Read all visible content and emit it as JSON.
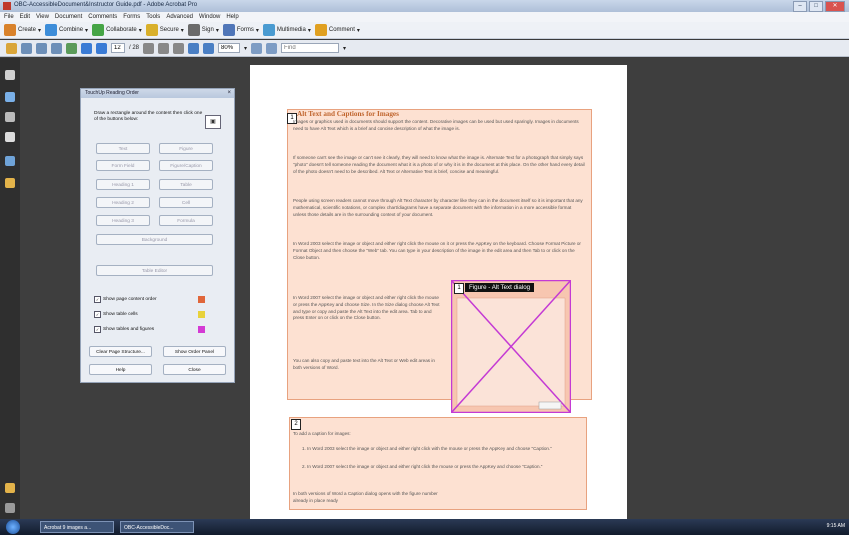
{
  "window": {
    "title": "OBC-AccessibleDocument&Instructor Guide.pdf - Adobe Acrobat Pro",
    "minimize": "–",
    "maximize": "□",
    "close": "✕"
  },
  "menu": [
    "File",
    "Edit",
    "View",
    "Document",
    "Comments",
    "Forms",
    "Tools",
    "Advanced",
    "Window",
    "Help"
  ],
  "toolbar1": [
    {
      "label": "Create",
      "color": "#d9822b"
    },
    {
      "label": "Combine",
      "color": "#3d8dd9"
    },
    {
      "label": "Collaborate",
      "color": "#46a546"
    },
    {
      "label": "Secure",
      "color": "#d9b02b"
    },
    {
      "label": "Sign",
      "color": "#6b6b6b"
    },
    {
      "label": "Forms",
      "color": "#5076b8"
    },
    {
      "label": "Multimedia",
      "color": "#4a9bd1"
    },
    {
      "label": "Comment",
      "color": "#e0a020"
    }
  ],
  "toolbar2": {
    "page_current": "12",
    "page_total": "/ 28",
    "zoom": "80%",
    "find_placeholder": "Find"
  },
  "dialog": {
    "title": "TouchUp Reading Order",
    "close": "×",
    "instruction": "Draw a rectangle around the content then click one of the buttons below:",
    "buttons": {
      "text": "Text",
      "figure": "Figure",
      "form_field": "Form Field",
      "figure_caption": "Figure/Caption",
      "heading1": "Heading 1",
      "table": "Table",
      "heading2": "Heading 2",
      "cell": "Cell",
      "heading3": "Heading 3",
      "formula": "Formula",
      "background": "Background",
      "table_editor": "Table Editor",
      "clear_page": "Clear Page Structure...",
      "show_order": "Show Order Panel",
      "help": "Help",
      "close": "Close"
    },
    "checkboxes": [
      {
        "label": "Show page content order",
        "checked": "✓",
        "color": "#e0663a"
      },
      {
        "label": "Show table cells",
        "checked": "✓",
        "color": "#e8d23a"
      },
      {
        "label": "Show tables and figures",
        "checked": "✓",
        "color": "#d43ad4"
      }
    ]
  },
  "document": {
    "block1_num": "1",
    "heading": "Alt Text and Captions for Images",
    "para1": "Images or graphics used in documents should support the content. Decorative images can be used but used sparingly. Images in documents need to have Alt Text which is a brief and concise description of what the image is.",
    "para2": "If someone can't see the image or can't see it clearly, they will need to know what the image is. Alternate Text for a photograph that simply says \"photo\" doesn't tell someone reading the document what it is a photo of or why it is in the document at this place. On the other hand every detail of the photo doesn't need to be described. Alt Text or Alternative Text is brief, concise and meaningful.",
    "para3": "People using screen readers cannot move through Alt Text character by character like they can in the document itself so it is important that any mathematical, scientific notations, or complex chart/diagrams have a separate document with the information in a more accessible format unless those details are in the surrounding context of your document.",
    "para4": "In Word 2003 select the image or object and either right click the mouse on it or press the AppKey on the keyboard. Choose Format Picture or Format Object and then choose the \"Web\" tab. You can type in your description of the image in the edit area and then Tab to or click on the Close button.",
    "para5": "In Word 2007 select the image or object and either right click the mouse or press the AppKey and choose Size. In the Size dialog choose Alt Text and type or copy and paste the Alt Text into the edit area. Tab to and press Enter on or click on the Close button.",
    "para6": "You can also copy and paste text into the Alt Text or Web edit areas in both versions of Word.",
    "figure_num": "1",
    "figure_label": "Figure - Alt Text dialog",
    "block2_num": "2",
    "caption_intro": "To add a caption for images:",
    "step1": "1.   In Word 2003 select the image or object and either right click with the mouse or press the AppKey and choose \"Caption.\"",
    "step2": "2.   In Word 2007 select the image or object and either right click the mouse or press the AppKey and choose \"Caption.\"",
    "closing": "In both versions of Word a Caption dialog opens with the figure number already in place ready"
  },
  "taskbar": {
    "task1": "Acrobat 9 images a...",
    "task2": "OBC-AccessibleDoc...",
    "clock": "9:15 AM"
  }
}
